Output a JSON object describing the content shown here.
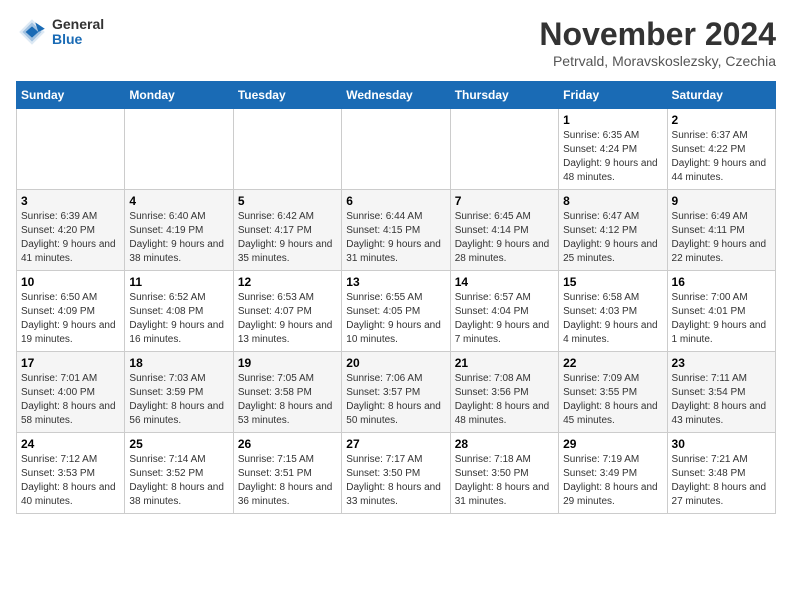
{
  "header": {
    "logo": {
      "general": "General",
      "blue": "Blue"
    },
    "title": "November 2024",
    "location": "Petrvald, Moravskoslezsky, Czechia"
  },
  "days_of_week": [
    "Sunday",
    "Monday",
    "Tuesday",
    "Wednesday",
    "Thursday",
    "Friday",
    "Saturday"
  ],
  "weeks": [
    [
      {
        "day": "",
        "info": ""
      },
      {
        "day": "",
        "info": ""
      },
      {
        "day": "",
        "info": ""
      },
      {
        "day": "",
        "info": ""
      },
      {
        "day": "",
        "info": ""
      },
      {
        "day": "1",
        "info": "Sunrise: 6:35 AM\nSunset: 4:24 PM\nDaylight: 9 hours and 48 minutes."
      },
      {
        "day": "2",
        "info": "Sunrise: 6:37 AM\nSunset: 4:22 PM\nDaylight: 9 hours and 44 minutes."
      }
    ],
    [
      {
        "day": "3",
        "info": "Sunrise: 6:39 AM\nSunset: 4:20 PM\nDaylight: 9 hours and 41 minutes."
      },
      {
        "day": "4",
        "info": "Sunrise: 6:40 AM\nSunset: 4:19 PM\nDaylight: 9 hours and 38 minutes."
      },
      {
        "day": "5",
        "info": "Sunrise: 6:42 AM\nSunset: 4:17 PM\nDaylight: 9 hours and 35 minutes."
      },
      {
        "day": "6",
        "info": "Sunrise: 6:44 AM\nSunset: 4:15 PM\nDaylight: 9 hours and 31 minutes."
      },
      {
        "day": "7",
        "info": "Sunrise: 6:45 AM\nSunset: 4:14 PM\nDaylight: 9 hours and 28 minutes."
      },
      {
        "day": "8",
        "info": "Sunrise: 6:47 AM\nSunset: 4:12 PM\nDaylight: 9 hours and 25 minutes."
      },
      {
        "day": "9",
        "info": "Sunrise: 6:49 AM\nSunset: 4:11 PM\nDaylight: 9 hours and 22 minutes."
      }
    ],
    [
      {
        "day": "10",
        "info": "Sunrise: 6:50 AM\nSunset: 4:09 PM\nDaylight: 9 hours and 19 minutes."
      },
      {
        "day": "11",
        "info": "Sunrise: 6:52 AM\nSunset: 4:08 PM\nDaylight: 9 hours and 16 minutes."
      },
      {
        "day": "12",
        "info": "Sunrise: 6:53 AM\nSunset: 4:07 PM\nDaylight: 9 hours and 13 minutes."
      },
      {
        "day": "13",
        "info": "Sunrise: 6:55 AM\nSunset: 4:05 PM\nDaylight: 9 hours and 10 minutes."
      },
      {
        "day": "14",
        "info": "Sunrise: 6:57 AM\nSunset: 4:04 PM\nDaylight: 9 hours and 7 minutes."
      },
      {
        "day": "15",
        "info": "Sunrise: 6:58 AM\nSunset: 4:03 PM\nDaylight: 9 hours and 4 minutes."
      },
      {
        "day": "16",
        "info": "Sunrise: 7:00 AM\nSunset: 4:01 PM\nDaylight: 9 hours and 1 minute."
      }
    ],
    [
      {
        "day": "17",
        "info": "Sunrise: 7:01 AM\nSunset: 4:00 PM\nDaylight: 8 hours and 58 minutes."
      },
      {
        "day": "18",
        "info": "Sunrise: 7:03 AM\nSunset: 3:59 PM\nDaylight: 8 hours and 56 minutes."
      },
      {
        "day": "19",
        "info": "Sunrise: 7:05 AM\nSunset: 3:58 PM\nDaylight: 8 hours and 53 minutes."
      },
      {
        "day": "20",
        "info": "Sunrise: 7:06 AM\nSunset: 3:57 PM\nDaylight: 8 hours and 50 minutes."
      },
      {
        "day": "21",
        "info": "Sunrise: 7:08 AM\nSunset: 3:56 PM\nDaylight: 8 hours and 48 minutes."
      },
      {
        "day": "22",
        "info": "Sunrise: 7:09 AM\nSunset: 3:55 PM\nDaylight: 8 hours and 45 minutes."
      },
      {
        "day": "23",
        "info": "Sunrise: 7:11 AM\nSunset: 3:54 PM\nDaylight: 8 hours and 43 minutes."
      }
    ],
    [
      {
        "day": "24",
        "info": "Sunrise: 7:12 AM\nSunset: 3:53 PM\nDaylight: 8 hours and 40 minutes."
      },
      {
        "day": "25",
        "info": "Sunrise: 7:14 AM\nSunset: 3:52 PM\nDaylight: 8 hours and 38 minutes."
      },
      {
        "day": "26",
        "info": "Sunrise: 7:15 AM\nSunset: 3:51 PM\nDaylight: 8 hours and 36 minutes."
      },
      {
        "day": "27",
        "info": "Sunrise: 7:17 AM\nSunset: 3:50 PM\nDaylight: 8 hours and 33 minutes."
      },
      {
        "day": "28",
        "info": "Sunrise: 7:18 AM\nSunset: 3:50 PM\nDaylight: 8 hours and 31 minutes."
      },
      {
        "day": "29",
        "info": "Sunrise: 7:19 AM\nSunset: 3:49 PM\nDaylight: 8 hours and 29 minutes."
      },
      {
        "day": "30",
        "info": "Sunrise: 7:21 AM\nSunset: 3:48 PM\nDaylight: 8 hours and 27 minutes."
      }
    ]
  ]
}
